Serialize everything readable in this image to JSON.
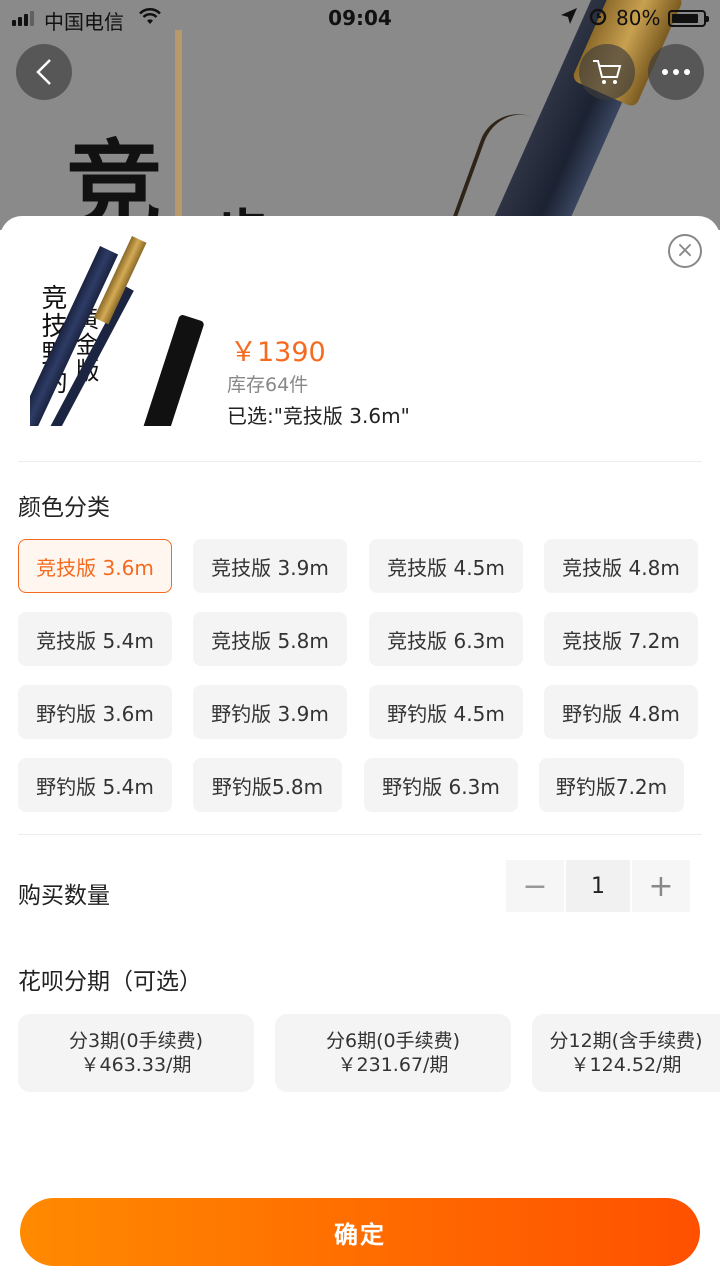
{
  "status_bar": {
    "carrier": "中国电信",
    "time": "09:04",
    "battery": "80%"
  },
  "background": {
    "glyph_1": "竞",
    "glyph_2": "步"
  },
  "nav_icons": {
    "back": "chevron-left-icon",
    "cart": "cart-icon",
    "more": "more-icon"
  },
  "product": {
    "thumb_text_main": "竞技野钓",
    "thumb_text_sub": "黄金版",
    "price": "￥1390",
    "stock": "库存64件",
    "selected": "已选:\"竞技版 3.6m\""
  },
  "color_section": {
    "title": "颜色分类",
    "options": [
      "竞技版 3.6m",
      "竞技版 3.9m",
      "竞技版 4.5m",
      "竞技版 4.8m",
      "竞技版 5.4m",
      "竞技版 5.8m",
      "竞技版 6.3m",
      "竞技版 7.2m",
      "野钓版 3.6m",
      "野钓版 3.9m",
      "野钓版 4.5m",
      "野钓版 4.8m",
      "野钓版 5.4m",
      "野钓版5.8m",
      "野钓版 6.3m",
      "野钓版7.2m"
    ],
    "selected_index": 0
  },
  "quantity": {
    "title": "购买数量",
    "minus": "−",
    "value": "1",
    "plus": "+"
  },
  "installments": {
    "title": "花呗分期（可选）",
    "options": [
      {
        "label": "分3期(0手续费)",
        "amount": "￥463.33/期"
      },
      {
        "label": "分6期(0手续费)",
        "amount": "￥231.67/期"
      },
      {
        "label": "分12期(含手续费)",
        "amount": "￥124.52/期"
      }
    ]
  },
  "confirm_label": "确定",
  "colors": {
    "accent": "#f56a1e",
    "button_start": "#ff8a00",
    "button_end": "#ff5000"
  }
}
